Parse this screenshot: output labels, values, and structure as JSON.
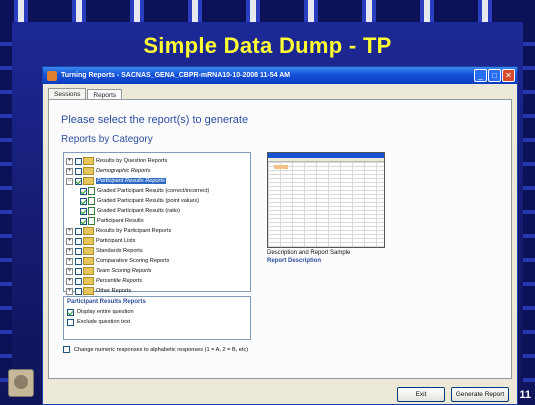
{
  "slide": {
    "title": "Simple Data Dump - TP",
    "page_number": "11"
  },
  "window": {
    "title": "Turning Reports - SACNAS_GENA_CBPR-mRNA10-10-2008 11-54 AM",
    "buttons": [
      "minimize-icon",
      "maximize-icon",
      "close-icon"
    ],
    "tabs": [
      {
        "label": "Sessions",
        "active": false
      },
      {
        "label": "Reports",
        "active": true
      }
    ],
    "heading": "Please select the report(s) to generate",
    "subheading": "Reports by Category",
    "tree": {
      "results_by_question": "Results by Question Reports",
      "demographic": "Demographic Reports",
      "participant_results": "Participant Results Reports",
      "graded_correct": "Graded Participant Results (correct/incorrect)",
      "graded_point": "Graded Participant Results (point values)",
      "graded_ratio": "Graded Participant Results (ratio)",
      "participant_results_child": "Participant Results",
      "results_by_participant": "Results by Participant Reports",
      "participant_lists": "Participant Lists",
      "standards": "Standards Reports",
      "comparative": "Comparative Scoring Reports",
      "team_scoring": "Team Scoring Reports",
      "percentile": "Percentile Reports",
      "other": "Other Reports"
    },
    "options": {
      "title": "Participant Results Reports",
      "display_entire_question": "Display entire question",
      "exclude_question_text": "Exclude question text"
    },
    "change_numeric": "Change numeric responses to alphabetic responses (1 = A, 2 = B, etc)",
    "preview_caption": "Description and Report Sample",
    "preview_link": "Report Description",
    "exit_label": "Exit",
    "generate_label": "Generate Report"
  },
  "colors": {
    "slide_background": "#1d2a9a",
    "title_color": "#ffff33",
    "accent_blue": "#2d4fa0"
  }
}
